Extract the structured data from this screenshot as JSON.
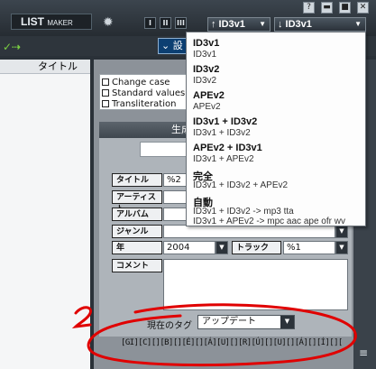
{
  "window": {
    "buttons": [
      "?",
      "▬",
      "■",
      "✕"
    ]
  },
  "app": {
    "title_main": "LIST",
    "title_sub": "MAKER",
    "gear_icon": "gear-icon"
  },
  "toolbar": {
    "view_buttons": [
      "I",
      "II",
      "III"
    ],
    "tag_select_left": "↑ ID3v1",
    "tag_select_right": "↓ ID3v1",
    "caret": "▼",
    "settings_tab": "⌄ 設"
  },
  "left_pane": {
    "column_header": "タイトル"
  },
  "options": {
    "items": [
      "Change case",
      "Standard values",
      "Transliteration"
    ]
  },
  "general": {
    "header": "生成"
  },
  "fields": {
    "title_label": "タイトル",
    "title_value": "%2",
    "artist_label": "アーティスト",
    "album_label": "アルバム",
    "genre_label": "ジャンル",
    "year_label": "年",
    "year_value": "2004",
    "track_label": "トラック",
    "track_value": "%1",
    "comment_label": "コメント"
  },
  "current_tag": {
    "label": "現在のタグ",
    "value": "アップデート"
  },
  "garbled_text": "[GI][C][][B][][É][][Á][U][][R][Ú][][U][][Á][][Í][][C][][O][][B][][É][C]",
  "dropdown": {
    "items": [
      {
        "title": "ID3v1",
        "sub": "ID3v1"
      },
      {
        "title": "ID3v2",
        "sub": "ID3v2"
      },
      {
        "title": "APEv2",
        "sub": "APEv2"
      },
      {
        "title": "ID3v1 + ID3v2",
        "sub": "ID3v1 + ID3v2"
      },
      {
        "title": "APEv2 + ID3v1",
        "sub": "ID3v1 + APEv2"
      },
      {
        "title": "完全",
        "sub": "ID3v1 + ID3v2 + APEv2"
      },
      {
        "title": "自動",
        "sub": "ID3v1 + ID3v2 -> mp3 tta"
      },
      {
        "title": "",
        "sub": "ID3v1 + APEv2 -> mpc aac ape ofr wv"
      }
    ]
  },
  "colors": {
    "accent_blue": "#0c3f72",
    "annotation_red": "#e00000"
  }
}
